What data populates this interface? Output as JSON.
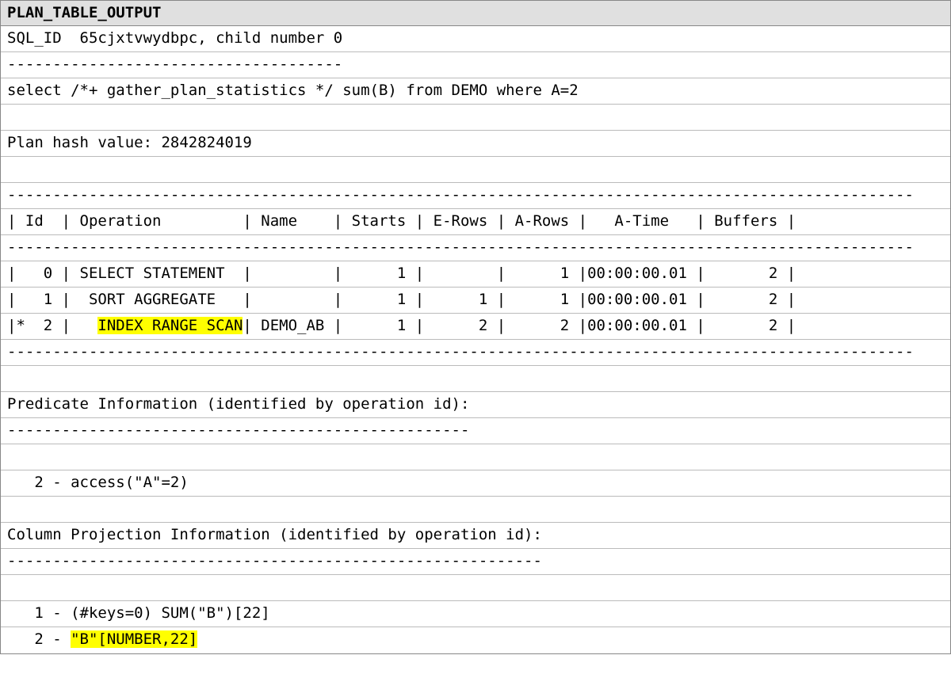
{
  "header": "PLAN_TABLE_OUTPUT",
  "lines": {
    "l0": "SQL_ID  65cjxtvwydbpc, child number 0",
    "l1": "-------------------------------------",
    "l2": "select /*+ gather_plan_statistics */ sum(B) from DEMO where A=2",
    "l3": " ",
    "l4": "Plan hash value: 2842824019",
    "l5": " ",
    "l6": "----------------------------------------------------------------------------------------------------",
    "l7": "| Id  | Operation         | Name    | Starts | E-Rows | A-Rows |   A-Time   | Buffers |",
    "l8": "----------------------------------------------------------------------------------------------------",
    "l9": "|   0 | SELECT STATEMENT  |         |      1 |        |      1 |00:00:00.01 |       2 |",
    "l10": "|   1 |  SORT AGGREGATE   |         |      1 |      1 |      1 |00:00:00.01 |       2 |",
    "l11a": "|*  2 |   ",
    "l11b": "INDEX RANGE SCAN",
    "l11c": "| DEMO_AB |      1 |      2 |      2 |00:00:00.01 |       2 |",
    "l12": "----------------------------------------------------------------------------------------------------",
    "l13": " ",
    "l14": "Predicate Information (identified by operation id):",
    "l15": "---------------------------------------------------",
    "l16": " ",
    "l17": "   2 - access(\"A\"=2)",
    "l18": " ",
    "l19": "Column Projection Information (identified by operation id):",
    "l20": "-----------------------------------------------------------",
    "l21": " ",
    "l22": "   1 - (#keys=0) SUM(\"B\")[22]",
    "l23a": "   2 - ",
    "l23b": "\"B\"[NUMBER,22]"
  }
}
